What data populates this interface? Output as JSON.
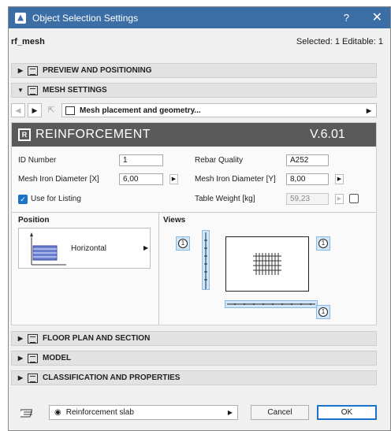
{
  "window": {
    "title": "Object Selection Settings",
    "help": "?",
    "close": "✕"
  },
  "header": {
    "object_name": "rf_mesh",
    "selection_info": "Selected: 1 Editable: 1"
  },
  "sections": {
    "preview": "PREVIEW AND POSITIONING",
    "mesh": "MESH SETTINGS",
    "floor": "FLOOR PLAN AND SECTION",
    "model": "MODEL",
    "classification": "CLASSIFICATION AND PROPERTIES"
  },
  "nav": {
    "page_label": "Mesh placement and geometry..."
  },
  "reinforcement": {
    "title": "REINFORCEMENT",
    "version": "V.6.01",
    "id_label": "ID Number",
    "id_value": "1",
    "quality_label": "Rebar Quality",
    "quality_value": "A252",
    "dx_label": "Mesh Iron Diameter [X]",
    "dx_value": "6,00",
    "dy_label": "Mesh Iron Diameter [Y]",
    "dy_value": "8,00",
    "listing_label": "Use for Listing",
    "listing_checked": true,
    "weight_label": "Table Weight [kg]",
    "weight_value": "59,23",
    "position_head": "Position",
    "position_value": "Horizontal",
    "views_head": "Views",
    "view_markers": [
      "1",
      "1",
      "1"
    ]
  },
  "footer": {
    "favorite_label": "Reinforcement slab",
    "cancel": "Cancel",
    "ok": "OK"
  },
  "colors": {
    "titlebar": "#3a6ea5",
    "accent": "#1a73c8",
    "banner": "#5a5a5a",
    "view_highlight": "#cfe6fb"
  }
}
